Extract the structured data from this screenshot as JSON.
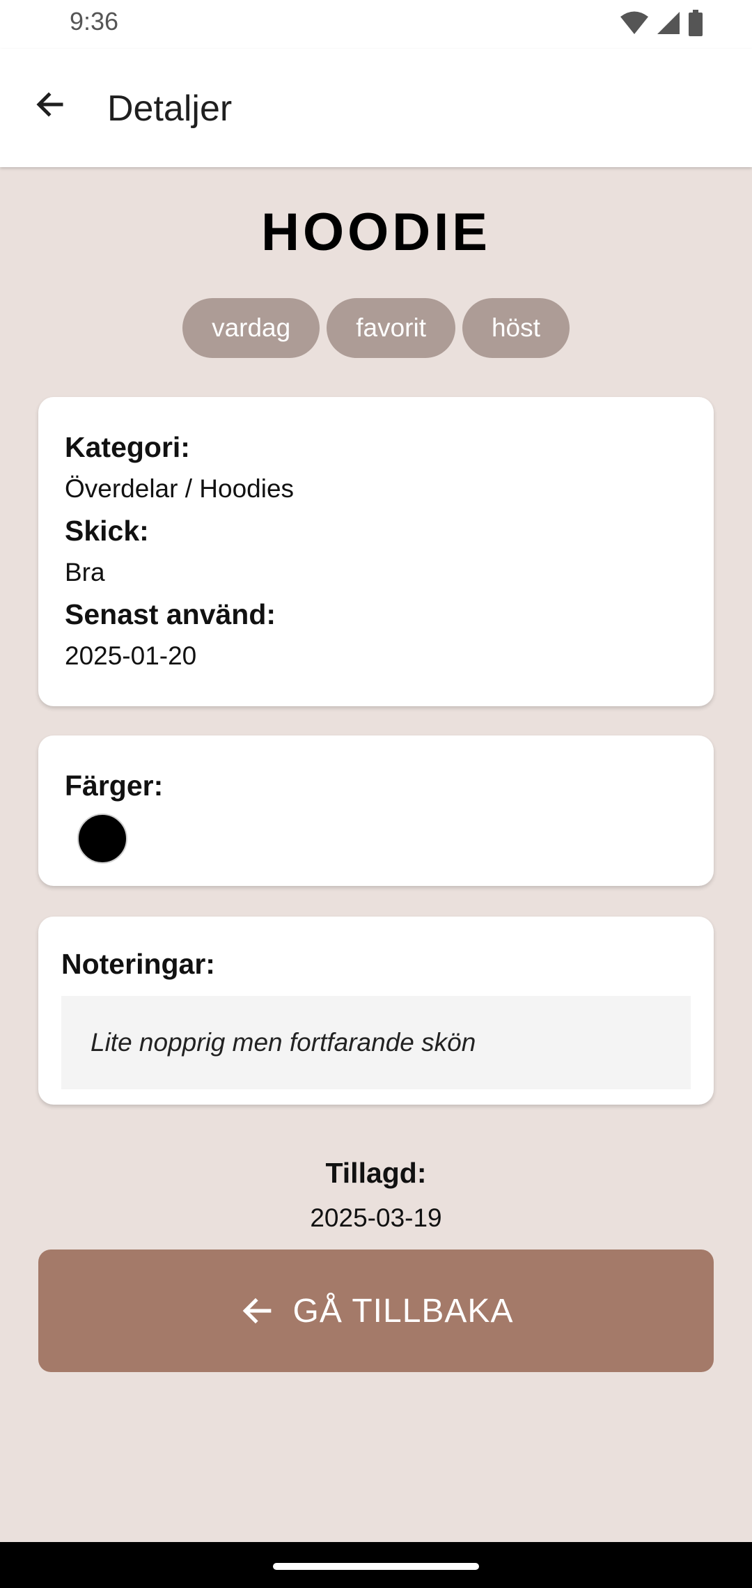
{
  "status_bar": {
    "time": "9:36",
    "icons": [
      "wifi-icon",
      "cellular-signal-icon",
      "battery-icon"
    ]
  },
  "app_bar": {
    "title": "Detaljer",
    "back_icon": "arrow-back-icon"
  },
  "item": {
    "name": "HOODIE",
    "tags": [
      "vardag",
      "favorit",
      "höst"
    ]
  },
  "info_card": {
    "category_label": "Kategori:",
    "category_value": "Överdelar / Hoodies",
    "condition_label": "Skick:",
    "condition_value": "Bra",
    "last_used_label": "Senast använd:",
    "last_used_value": "2025-01-20"
  },
  "colors_card": {
    "label": "Färger:",
    "swatches": [
      "#000000"
    ]
  },
  "notes_card": {
    "label": "Noteringar:",
    "text": "Lite nopprig men fortfarande skön"
  },
  "added": {
    "label": "Tillagd:",
    "value": "2025-03-19"
  },
  "back_button": {
    "label": "GÅ TILLBAKA",
    "icon": "arrow-back-icon"
  },
  "colors": {
    "background": "#eae0dc",
    "tag": "#ad9c96",
    "accent": "#a47a69"
  }
}
